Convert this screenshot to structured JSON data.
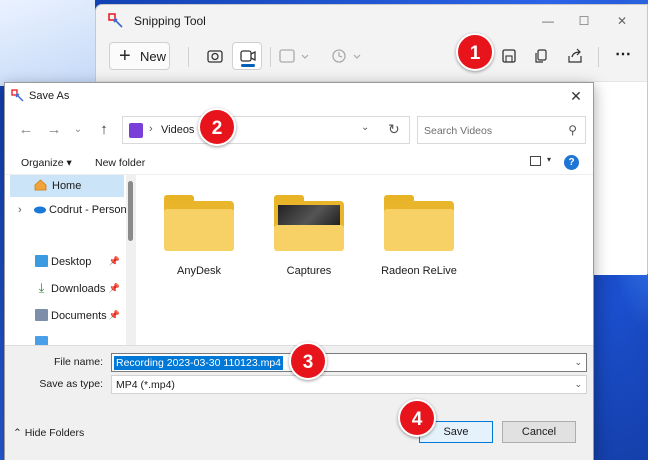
{
  "snipping_tool": {
    "title": "Snipping Tool",
    "new_label": "New",
    "more_label": "⋯"
  },
  "badges": [
    "1",
    "2",
    "3",
    "4"
  ],
  "dialog": {
    "title": "Save As",
    "address_path": "Videos",
    "search_placeholder": "Search Videos",
    "organize_label": "Organize",
    "new_folder_label": "New folder",
    "help_label": "?",
    "sidebar": {
      "items": [
        {
          "label": "Home"
        },
        {
          "label": "Codrut - Personal"
        },
        {
          "label": "Desktop"
        },
        {
          "label": "Downloads"
        },
        {
          "label": "Documents"
        }
      ]
    },
    "folders": [
      {
        "name": "AnyDesk"
      },
      {
        "name": "Captures"
      },
      {
        "name": "Radeon ReLive"
      }
    ],
    "file_name_label": "File name:",
    "file_name_value": "Recording 2023-03-30 110123.mp4",
    "save_as_type_label": "Save as type:",
    "save_as_type_value": "MP4 (*.mp4)",
    "hide_folders_label": "Hide Folders",
    "save_label": "Save",
    "cancel_label": "Cancel"
  }
}
